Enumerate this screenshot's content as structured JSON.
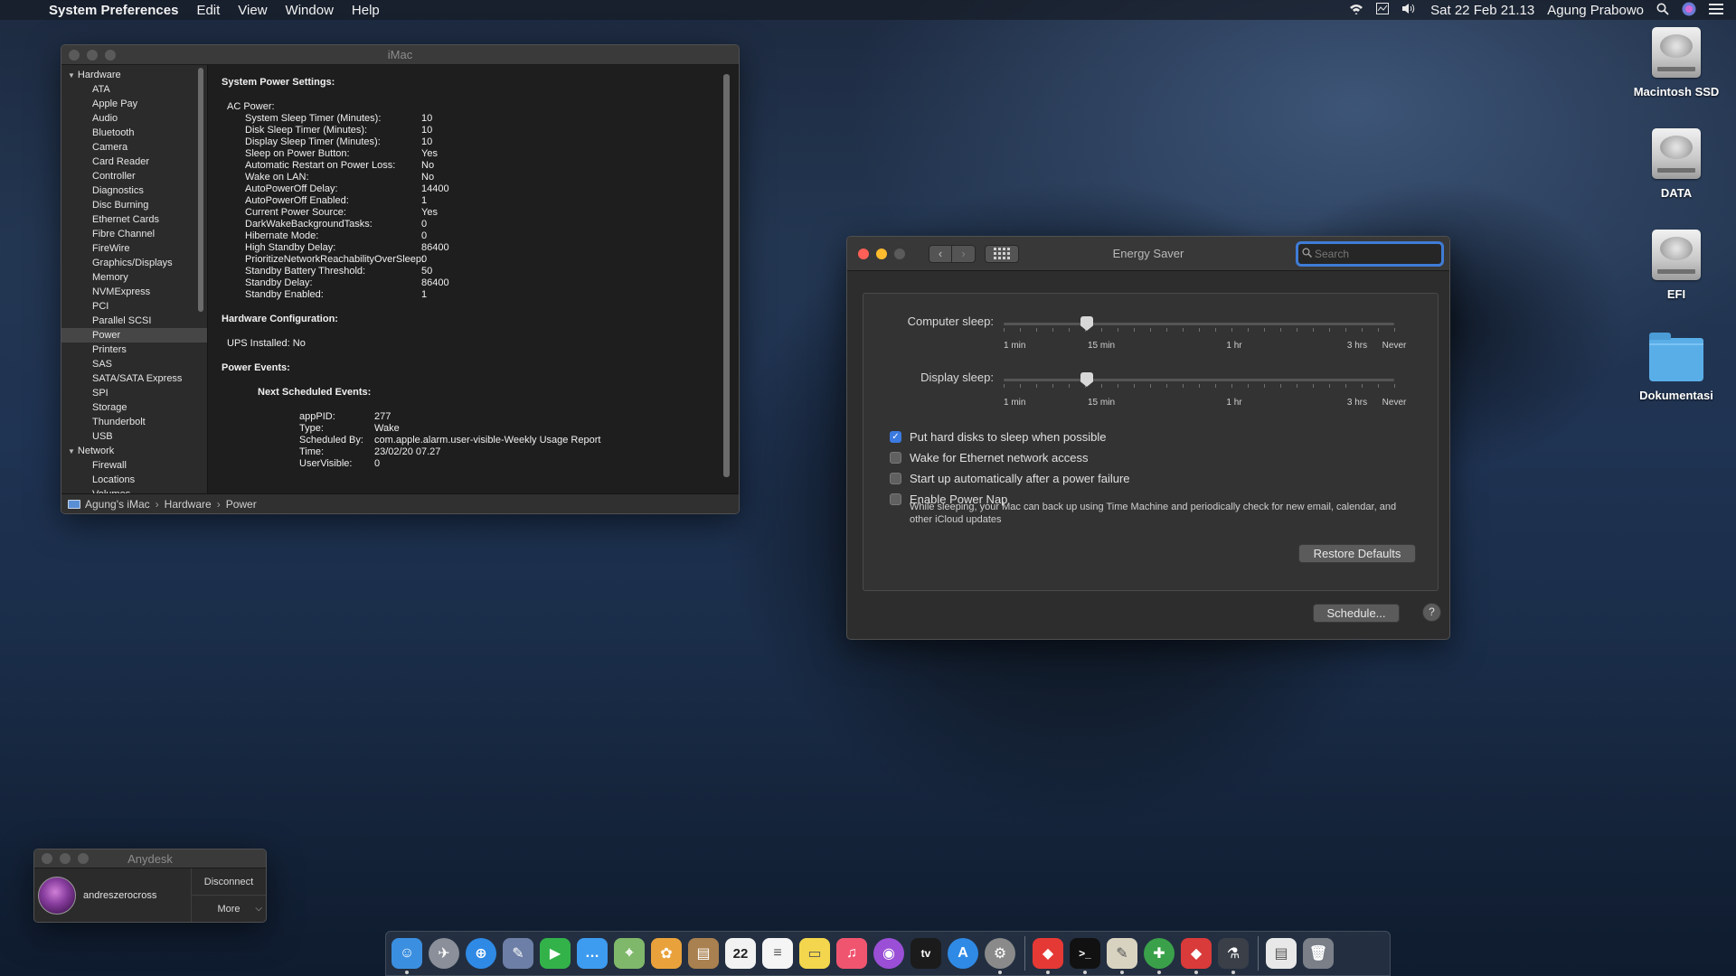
{
  "menubar": {
    "apple": "",
    "app_name": "System Preferences",
    "menus": [
      "Edit",
      "View",
      "Window",
      "Help"
    ],
    "datetime": "Sat 22 Feb  21.13",
    "user": "Agung Prabowo",
    "status_icons": [
      "wifi-icon",
      "activity-monitor-icon",
      "volume-icon"
    ]
  },
  "sysinfo": {
    "title": "iMac",
    "sidebar": {
      "hardware_label": "Hardware",
      "hardware_items": [
        "ATA",
        "Apple Pay",
        "Audio",
        "Bluetooth",
        "Camera",
        "Card Reader",
        "Controller",
        "Diagnostics",
        "Disc Burning",
        "Ethernet Cards",
        "Fibre Channel",
        "FireWire",
        "Graphics/Displays",
        "Memory",
        "NVMExpress",
        "PCI",
        "Parallel SCSI",
        "Power",
        "Printers",
        "SAS",
        "SATA/SATA Express",
        "SPI",
        "Storage",
        "Thunderbolt",
        "USB"
      ],
      "selected": "Power",
      "network_label": "Network",
      "network_items": [
        "Firewall",
        "Locations",
        "Volumes"
      ]
    },
    "content": {
      "heading": "System Power Settings:",
      "ac_label": "AC Power:",
      "ac_rows": [
        [
          "System Sleep Timer (Minutes):",
          "10"
        ],
        [
          "Disk Sleep Timer (Minutes):",
          "10"
        ],
        [
          "Display Sleep Timer (Minutes):",
          "10"
        ],
        [
          "Sleep on Power Button:",
          "Yes"
        ],
        [
          "Automatic Restart on Power Loss:",
          "No"
        ],
        [
          "Wake on LAN:",
          "No"
        ],
        [
          "AutoPowerOff Delay:",
          "14400"
        ],
        [
          "AutoPowerOff Enabled:",
          "1"
        ],
        [
          "Current Power Source:",
          "Yes"
        ],
        [
          "DarkWakeBackgroundTasks:",
          "0"
        ],
        [
          "Hibernate Mode:",
          "0"
        ],
        [
          "High Standby Delay:",
          "86400"
        ],
        [
          "PrioritizeNetworkReachabilityOverSleep:",
          "0"
        ],
        [
          "Standby Battery Threshold:",
          "50"
        ],
        [
          "Standby Delay:",
          "86400"
        ],
        [
          "Standby Enabled:",
          "1"
        ]
      ],
      "hw_config": "Hardware Configuration:",
      "ups": "UPS Installed:  No",
      "power_events": "Power Events:",
      "next_events": "Next Scheduled Events:",
      "event_rows": [
        [
          "appPID:",
          "277"
        ],
        [
          "Type:",
          "Wake"
        ],
        [
          "Scheduled By:",
          "com.apple.alarm.user-visible-Weekly Usage Report"
        ],
        [
          "Time:",
          "23/02/20 07.27"
        ],
        [
          "UserVisible:",
          "0"
        ]
      ]
    },
    "breadcrumb": [
      "Agung's iMac",
      "Hardware",
      "Power"
    ],
    "breadcrumb_sep": "›"
  },
  "energy": {
    "title": "Energy Saver",
    "search_placeholder": "Search",
    "computer_sleep": {
      "label": "Computer sleep:",
      "value_label": "15 min"
    },
    "display_sleep": {
      "label": "Display sleep:",
      "value_label": "15 min"
    },
    "tick_labels": [
      "1 min",
      "15 min",
      "1 hr",
      "3 hrs",
      "Never"
    ],
    "checkboxes": [
      {
        "label": "Put hard disks to sleep when possible",
        "checked": true
      },
      {
        "label": "Wake for Ethernet network access",
        "checked": false
      },
      {
        "label": "Start up automatically after a power failure",
        "checked": false
      },
      {
        "label": "Enable Power Nap",
        "checked": false
      }
    ],
    "power_nap_desc": "While sleeping, your Mac can back up using Time Machine and periodically check for new email, calendar, and other iCloud updates",
    "restore_defaults": "Restore Defaults",
    "schedule": "Schedule...",
    "help": "?",
    "check_mark": "✓",
    "nav_back": "‹",
    "nav_forward": "›"
  },
  "desktop_icons": [
    {
      "name": "Macintosh SSD",
      "type": "disk"
    },
    {
      "name": "DATA",
      "type": "disk"
    },
    {
      "name": "EFI",
      "type": "disk"
    },
    {
      "name": "Dokumentasi",
      "type": "folder"
    }
  ],
  "anydesk": {
    "title": "Anydesk",
    "user": "andreszerocross",
    "disconnect": "Disconnect",
    "more": "More",
    "chevron": "⌵"
  },
  "dock": {
    "calendar_day": "22",
    "apps": [
      {
        "name": "finder-icon",
        "color": "#3b8fe0",
        "glyph": "☺",
        "running": true
      },
      {
        "name": "launchpad-icon",
        "color": "#8a8f99",
        "glyph": "✈",
        "running": false
      },
      {
        "name": "safari-icon",
        "color": "#2f8ae6",
        "glyph": "⊕",
        "running": false
      },
      {
        "name": "preview-icon",
        "color": "#6d7fa6",
        "glyph": "✎",
        "running": false
      },
      {
        "name": "facetime-icon",
        "color": "#33b24a",
        "glyph": "▶",
        "running": false
      },
      {
        "name": "messages-icon",
        "color": "#3d9bf0",
        "glyph": "…",
        "running": false
      },
      {
        "name": "maps-icon",
        "color": "#7fb86a",
        "glyph": "⌖",
        "running": false
      },
      {
        "name": "photos-icon",
        "color": "#e9a23b",
        "glyph": "✿",
        "running": false
      },
      {
        "name": "notes-brown-icon",
        "color": "#a9804f",
        "glyph": "▤",
        "running": false
      },
      {
        "name": "calendar-icon",
        "color": "#f2f2f2",
        "glyph": "",
        "running": false
      },
      {
        "name": "reminders-icon",
        "color": "#f5f5f5",
        "glyph": "≡",
        "running": false
      },
      {
        "name": "notes-icon",
        "color": "#f3d64d",
        "glyph": "▭",
        "running": false
      },
      {
        "name": "music-icon",
        "color": "#f05570",
        "glyph": "♫",
        "running": false
      },
      {
        "name": "podcasts-icon",
        "color": "#9a4fd6",
        "glyph": "◉",
        "running": false
      },
      {
        "name": "tv-icon",
        "color": "#1b1b1b",
        "glyph": "tv",
        "running": false
      },
      {
        "name": "app-store-icon",
        "color": "#2f8ae6",
        "glyph": "A",
        "running": false
      },
      {
        "name": "system-preferences-icon",
        "color": "#8a8a8a",
        "glyph": "⚙",
        "running": true
      },
      {
        "name": "anydesk-icon",
        "color": "#e53935",
        "glyph": "◆",
        "running": true
      },
      {
        "name": "terminal-icon",
        "color": "#111111",
        "glyph": ">_",
        "running": true
      },
      {
        "name": "script-editor-icon",
        "color": "#d8d2c0",
        "glyph": "✎",
        "running": true
      },
      {
        "name": "disk-utility-icon",
        "color": "#3aa14a",
        "glyph": "✚",
        "running": true
      },
      {
        "name": "clover-icon",
        "color": "#d93a3a",
        "glyph": "◆",
        "running": true
      },
      {
        "name": "system-information-icon",
        "color": "#3a3f48",
        "glyph": "⚗",
        "running": true
      },
      {
        "name": "documents-icon",
        "color": "#e8e8e8",
        "glyph": "▤",
        "running": false
      },
      {
        "name": "trash-icon",
        "color": "#7a7f88",
        "glyph": "🗑",
        "running": false
      }
    ]
  }
}
